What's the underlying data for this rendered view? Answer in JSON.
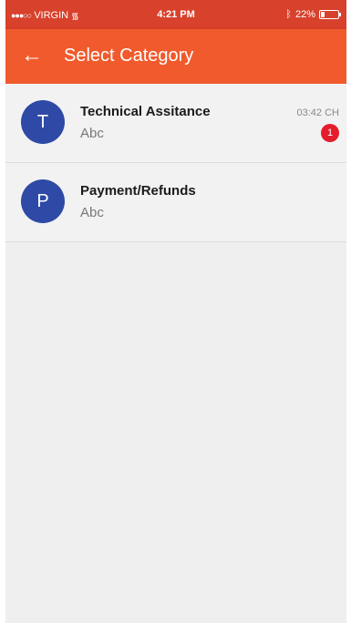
{
  "status_bar": {
    "carrier": "VIRGIN",
    "time": "4:21 PM",
    "battery": "22%",
    "battery_level": 0.22
  },
  "app_bar": {
    "title": "Select Category"
  },
  "categories": [
    {
      "initial": "T",
      "name": "Technical Assitance",
      "subtitle": "Abc",
      "time": "03:42 CH",
      "badge": "1"
    },
    {
      "initial": "P",
      "name": "Payment/Refunds",
      "subtitle": "Abc"
    }
  ],
  "colors": {
    "status_bar": "#d8412c",
    "app_bar": "#f05a2c",
    "avatar": "#2e49a6",
    "badge": "#e41c2c",
    "background": "#efefef"
  }
}
